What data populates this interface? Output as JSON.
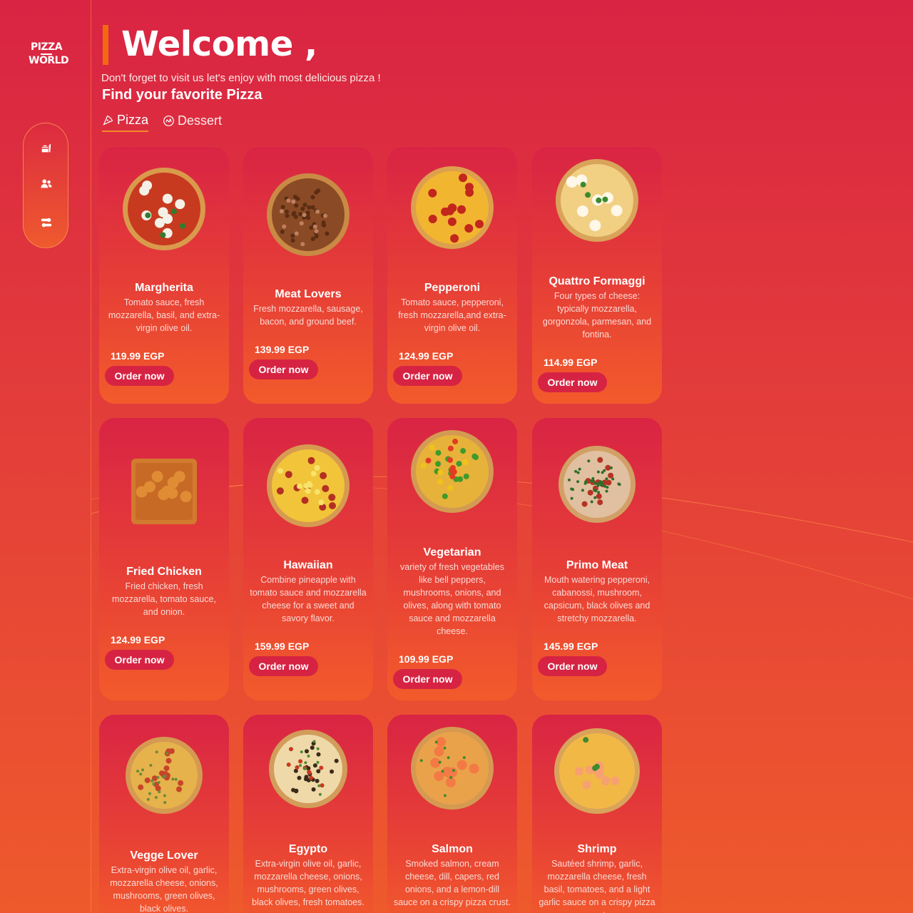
{
  "brand": {
    "logo_line1": "PIZZA",
    "logo_line2": "WORLD"
  },
  "sidebar": {
    "items": [
      {
        "icon": "food-icon"
      },
      {
        "icon": "users-icon"
      },
      {
        "icon": "toggle-icon"
      }
    ]
  },
  "header": {
    "title": "Welcome ,",
    "subtitle": "Don't forget to visit us let's enjoy with most delicious pizza !",
    "find_label": "Find your favorite Pizza"
  },
  "tabs": [
    {
      "label": "Pizza",
      "icon": "pizza-slice-icon",
      "active": true
    },
    {
      "label": "Dessert",
      "icon": "dessert-icon",
      "active": false
    }
  ],
  "order_label": "Order now",
  "colors": {
    "accent": "#f26a10",
    "button": "#d62343",
    "bg_top": "#d92443",
    "bg_bottom": "#ee5a2c"
  },
  "products": [
    {
      "name": "Margherita",
      "desc": "Tomato sauce, fresh mozzarella, basil, and extra-virgin olive oil.",
      "price": "119.99 EGP"
    },
    {
      "name": "Meat Lovers",
      "desc": "Fresh mozzarella, sausage, bacon, and ground beef.",
      "price": "139.99 EGP"
    },
    {
      "name": "Pepperoni",
      "desc": "Tomato sauce, pepperoni, fresh mozzarella,and extra-virgin olive oil.",
      "price": "124.99 EGP"
    },
    {
      "name": "Quattro Formaggi",
      "desc": "Four types of cheese: typically mozzarella, gorgonzola, parmesan, and fontina.",
      "price": "114.99 EGP"
    },
    {
      "name": "Fried Chicken",
      "desc": "Fried chicken, fresh mozzarella, tomato sauce, and onion.",
      "price": "124.99 EGP"
    },
    {
      "name": "Hawaiian",
      "desc": "Combine pineapple with tomato sauce and mozzarella cheese for a sweet and savory flavor.",
      "price": "159.99 EGP"
    },
    {
      "name": "Vegetarian",
      "desc": "variety of fresh vegetables like bell peppers, mushrooms, onions, and olives, along with tomato sauce and mozzarella cheese.",
      "price": "109.99 EGP"
    },
    {
      "name": "Primo Meat",
      "desc": "Mouth watering pepperoni, cabanossi, mushroom, capsicum, black olives and stretchy mozzarella.",
      "price": "145.99 EGP"
    },
    {
      "name": "Vegge Lover",
      "desc": "Extra-virgin olive oil, garlic, mozzarella cheese, onions, mushrooms, green olives, black olives.",
      "price": ""
    },
    {
      "name": "Egypto",
      "desc": "Extra-virgin olive oil, garlic, mozzarella cheese, onions, mushrooms, green olives, black olives, fresh tomatoes.",
      "price": ""
    },
    {
      "name": "Salmon",
      "desc": "Smoked salmon, cream cheese, dill, capers, red onions, and a lemon-dill sauce on a crispy pizza crust.",
      "price": ""
    },
    {
      "name": "Shrimp",
      "desc": "Sautéed shrimp, garlic, mozzarella cheese, fresh basil, tomatoes, and a light garlic sauce on a crispy pizza crust.",
      "price": ""
    }
  ]
}
